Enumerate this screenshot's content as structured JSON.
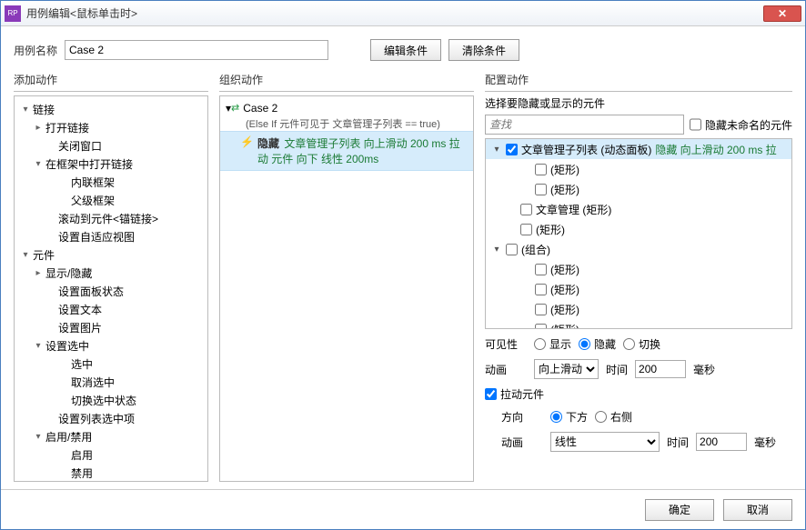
{
  "window": {
    "title": "用例编辑<鼠标单击时>",
    "app_badge": "RP"
  },
  "namerow": {
    "label": "用例名称",
    "value": "Case 2",
    "edit_cond": "编辑条件",
    "clear_cond": "清除条件"
  },
  "sections": {
    "add": "添加动作",
    "org": "组织动作",
    "cfg": "配置动作"
  },
  "add_tree": [
    {
      "label": "链接",
      "indent": 1,
      "arrow": "down"
    },
    {
      "label": "打开链接",
      "indent": 2,
      "arrow": "right"
    },
    {
      "label": "关闭窗口",
      "indent": 3,
      "arrow": ""
    },
    {
      "label": "在框架中打开链接",
      "indent": 2,
      "arrow": "down"
    },
    {
      "label": "内联框架",
      "indent": 4,
      "arrow": ""
    },
    {
      "label": "父级框架",
      "indent": 4,
      "arrow": ""
    },
    {
      "label": "滚动到元件<锚链接>",
      "indent": 3,
      "arrow": ""
    },
    {
      "label": "设置自适应视图",
      "indent": 3,
      "arrow": ""
    },
    {
      "label": "元件",
      "indent": 1,
      "arrow": "down"
    },
    {
      "label": "显示/隐藏",
      "indent": 2,
      "arrow": "right"
    },
    {
      "label": "设置面板状态",
      "indent": 3,
      "arrow": ""
    },
    {
      "label": "设置文本",
      "indent": 3,
      "arrow": ""
    },
    {
      "label": "设置图片",
      "indent": 3,
      "arrow": ""
    },
    {
      "label": "设置选中",
      "indent": 2,
      "arrow": "down"
    },
    {
      "label": "选中",
      "indent": 4,
      "arrow": ""
    },
    {
      "label": "取消选中",
      "indent": 4,
      "arrow": ""
    },
    {
      "label": "切换选中状态",
      "indent": 4,
      "arrow": ""
    },
    {
      "label": "设置列表选中项",
      "indent": 3,
      "arrow": ""
    },
    {
      "label": "启用/禁用",
      "indent": 2,
      "arrow": "down"
    },
    {
      "label": "启用",
      "indent": 4,
      "arrow": ""
    },
    {
      "label": "禁用",
      "indent": 4,
      "arrow": ""
    }
  ],
  "org": {
    "case_name": "Case 2",
    "case_arrow": "▾",
    "condition": "(Else If 元件可见于 文章管理子列表 == true)",
    "action_name": "隐藏",
    "action_text": "文章管理子列表 向上滑动 200 ms 拉动 元件 向下 线性 200ms"
  },
  "cfg": {
    "select_label": "选择要隐藏或显示的元件",
    "search_placeholder": "查找",
    "hide_unnamed": "隐藏未命名的元件",
    "widgets": [
      {
        "pad": 1,
        "arrow": "down",
        "checked": true,
        "text": "文章管理子列表 (动态面板)",
        "green": "隐藏 向上滑动 200 ms 拉",
        "sel": true
      },
      {
        "pad": 3,
        "arrow": "",
        "checked": false,
        "text": "(矩形)"
      },
      {
        "pad": 3,
        "arrow": "",
        "checked": false,
        "text": "(矩形)"
      },
      {
        "pad": 2,
        "arrow": "",
        "checked": false,
        "text": "文章管理 (矩形)"
      },
      {
        "pad": 2,
        "arrow": "",
        "checked": false,
        "text": "(矩形)"
      },
      {
        "pad": 1,
        "arrow": "down",
        "checked": false,
        "text": "(组合)"
      },
      {
        "pad": 3,
        "arrow": "",
        "checked": false,
        "text": "(矩形)"
      },
      {
        "pad": 3,
        "arrow": "",
        "checked": false,
        "text": "(矩形)"
      },
      {
        "pad": 3,
        "arrow": "",
        "checked": false,
        "text": "(矩形)"
      },
      {
        "pad": 3,
        "arrow": "",
        "checked": false,
        "text": "(矩形)"
      }
    ],
    "visibility": {
      "label": "可见性",
      "show": "显示",
      "hide": "隐藏",
      "toggle": "切换",
      "value": "hide"
    },
    "anim": {
      "label": "动画",
      "value": "向上滑动",
      "time_label": "时间",
      "time_value": "200",
      "unit": "毫秒"
    },
    "pull": {
      "label": "拉动元件",
      "checked": true
    },
    "dir": {
      "label": "方向",
      "below": "下方",
      "right": "右侧",
      "value": "below"
    },
    "anim2": {
      "label": "动画",
      "value": "线性",
      "time_label": "时间",
      "time_value": "200",
      "unit": "毫秒"
    }
  },
  "footer": {
    "ok": "确定",
    "cancel": "取消"
  }
}
